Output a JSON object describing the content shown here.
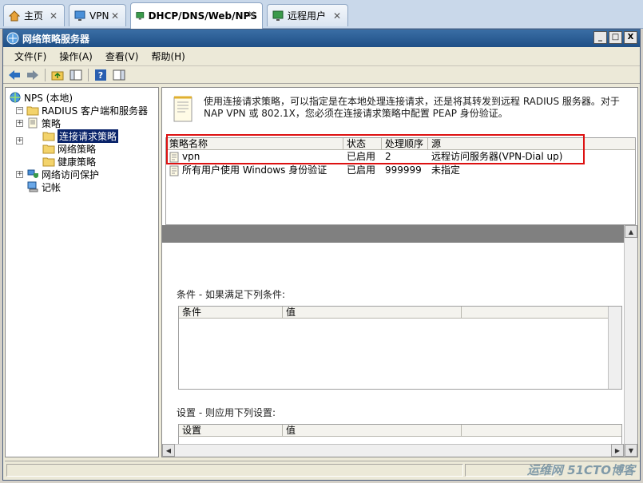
{
  "tabs": [
    {
      "label": "主页",
      "icon": "home-icon"
    },
    {
      "label": "VPN",
      "icon": "monitor-icon"
    },
    {
      "label": "DHCP/DNS/Web/NPS",
      "icon": "monitor-icon",
      "active": true
    },
    {
      "label": "远程用户",
      "icon": "monitor-icon"
    }
  ],
  "window": {
    "title": "网络策略服务器",
    "buttons": {
      "minimize": "_",
      "maximize": "□",
      "close": "X"
    }
  },
  "menu": [
    "文件(F)",
    "操作(A)",
    "查看(V)",
    "帮助(H)"
  ],
  "tree": {
    "root": "NPS (本地)",
    "radius": "RADIUS 客户端和服务器",
    "policies": "策略",
    "connection_request": "连接请求策略",
    "network_policies": "网络策略",
    "health_policies": "健康策略",
    "nap": "网络访问保护",
    "accounting": "记帐"
  },
  "description": "使用连接请求策略，可以指定是在本地处理连接请求，还是将其转发到远程 RADIUS 服务器。对于 NAP VPN 或 802.1X，您必须在连接请求策略中配置 PEAP 身份验证。",
  "policy_list": {
    "columns": [
      "策略名称",
      "状态",
      "处理顺序",
      "源"
    ],
    "rows": [
      {
        "name": "vpn",
        "status": "已启用",
        "order": "2",
        "source": "远程访问服务器(VPN-Dial up)"
      },
      {
        "name": "所有用户使用 Windows 身份验证",
        "status": "已启用",
        "order": "999999",
        "source": "未指定"
      }
    ]
  },
  "conditions": {
    "label": "条件 - 如果满足下列条件:",
    "columns": [
      "条件",
      "值"
    ]
  },
  "settings": {
    "label": "设置 - 则应用下列设置:",
    "columns": [
      "设置",
      "值"
    ]
  },
  "watermark": "运维网 51CTO博客",
  "colors": {
    "title_bar": "#1f4f86",
    "selection": "#0a246a",
    "highlight_border": "#dd1111"
  }
}
